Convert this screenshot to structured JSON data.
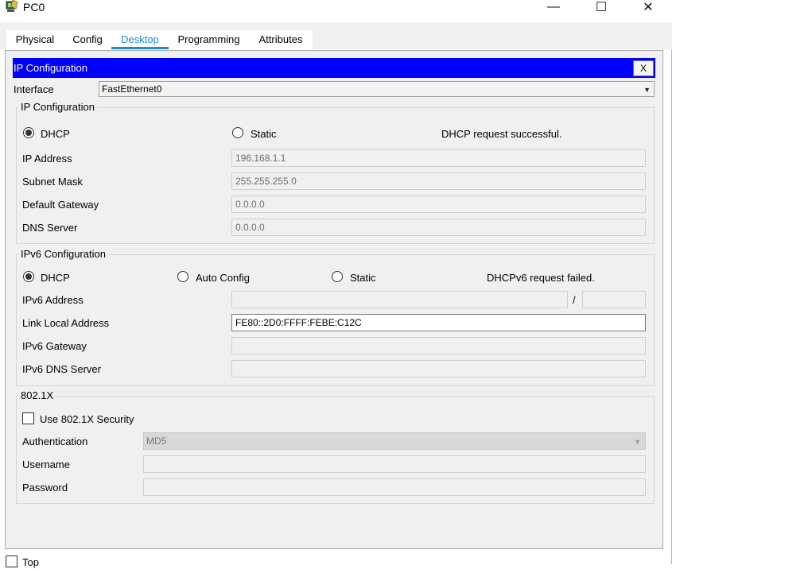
{
  "window": {
    "title": "PC0",
    "minimize_glyph": "—",
    "maximize_glyph": "☐",
    "close_glyph": "✕"
  },
  "tabs": [
    {
      "label": "Physical"
    },
    {
      "label": "Config"
    },
    {
      "label": "Desktop",
      "active": true
    },
    {
      "label": "Programming"
    },
    {
      "label": "Attributes"
    }
  ],
  "panel": {
    "title": "IP Configuration",
    "close_label": "X"
  },
  "interface": {
    "label": "Interface",
    "value": "FastEthernet0"
  },
  "ipv4": {
    "legend": "IP Configuration",
    "dhcp_label": "DHCP",
    "static_label": "Static",
    "selected": "DHCP",
    "status": "DHCP request successful.",
    "ip_label": "IP Address",
    "ip_value": "196.168.1.1",
    "mask_label": "Subnet Mask",
    "mask_value": "255.255.255.0",
    "gateway_label": "Default Gateway",
    "gateway_value": "0.0.0.0",
    "dns_label": "DNS Server",
    "dns_value": "0.0.0.0"
  },
  "ipv6": {
    "legend": "IPv6 Configuration",
    "dhcp_label": "DHCP",
    "auto_label": "Auto Config",
    "static_label": "Static",
    "selected": "DHCP",
    "status": "DHCPv6 request failed.",
    "address_label": "IPv6 Address",
    "address_value": "",
    "prefix_separator": "/",
    "prefix_value": "",
    "link_local_label": "Link Local Address",
    "link_local_value": "FE80::2D0:FFFF:FEBE:C12C",
    "gateway_label": "IPv6 Gateway",
    "gateway_value": "",
    "dns_label": "IPv6 DNS Server",
    "dns_value": ""
  },
  "dot1x": {
    "legend": "802.1X",
    "use_label": "Use 802.1X Security",
    "use_checked": false,
    "auth_label": "Authentication",
    "auth_value": "MD5",
    "username_label": "Username",
    "username_value": "",
    "password_label": "Password",
    "password_value": ""
  },
  "footer": {
    "top_label": "Top",
    "top_checked": false
  },
  "colors": {
    "header_bar": "#0000ff",
    "active_tab": "#1f8ad9"
  }
}
